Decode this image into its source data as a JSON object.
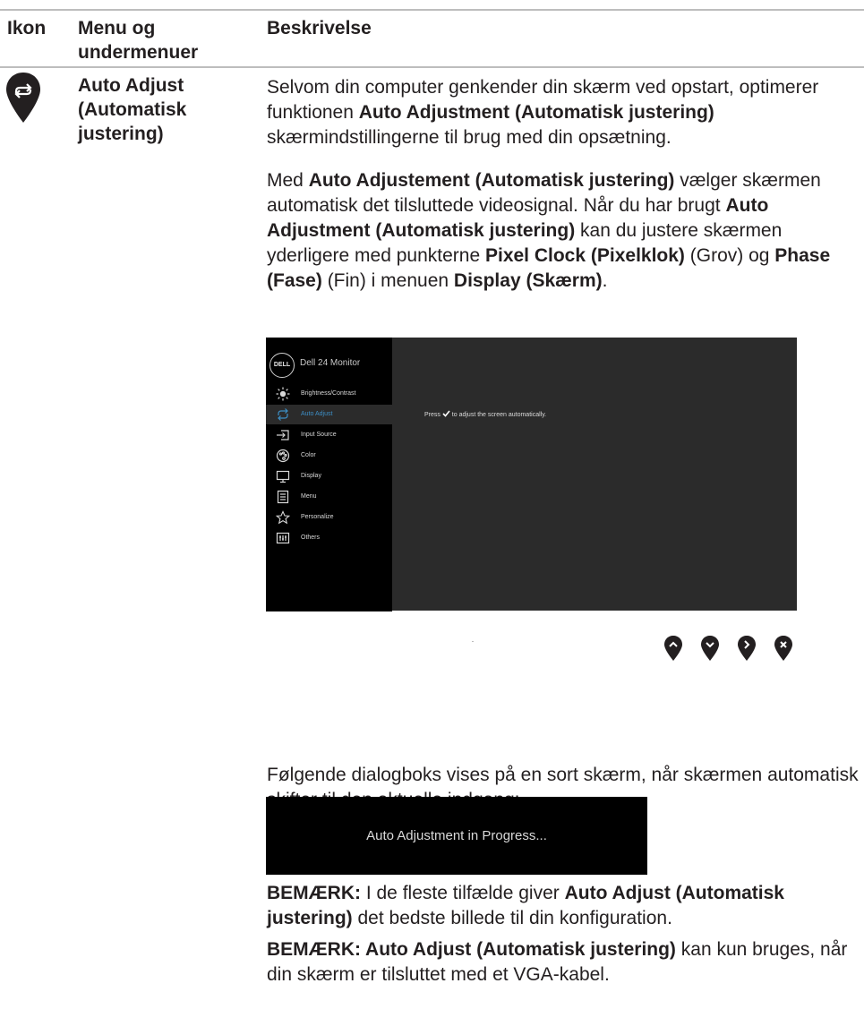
{
  "header": {
    "icon_col": "Ikon",
    "menu_col": "Menu og undermenuer",
    "desc_col": "Beskrivelse"
  },
  "row": {
    "icon": "auto-adjust-icon",
    "menu_title": "Auto Adjust (Automatisk justering)",
    "p1": {
      "a": "Selvom din computer genkender din skærm ved opstart, optimerer funktionen ",
      "b": "Auto Adjustment (Automatisk justering)",
      "c": " skærmindstillingerne til brug med din opsætning."
    },
    "p2": {
      "a": "Med ",
      "b": "Auto Adjustement (Automatisk justering)",
      "c": " vælger skærmen automatisk det tilsluttede videosignal. Når du har brugt ",
      "d": "Auto Adjustment (Automatisk justering)",
      "e": " kan du justere skærmen yderligere med punkterne ",
      "f": "Pixel Clock (Pixelklok)",
      "g": " (Grov) og ",
      "h": "Phase (Fase)",
      "i": " (Fin) i menuen ",
      "j": "Display (Skærm)",
      "k": "."
    },
    "p3": "Følgende dialogboks vises på en sort skærm, når skærmen automatisk skifter til den aktuelle indgang:",
    "p4": {
      "a": "BEMÆRK:",
      "b": " I de fleste tilfælde giver ",
      "c": "Auto Adjust (Automatisk justering)",
      "d": " det bedste billede til din konfiguration."
    },
    "p5": {
      "a": "BEMÆRK: Auto Adjust (Automatisk justering)",
      "b": " kan kun bruges, når din skærm er tilsluttet med et VGA-kabel."
    }
  },
  "osd": {
    "logo": "DELL",
    "title": "Dell 24 Monitor",
    "items": [
      {
        "label": "Brightness/Contrast",
        "icon": "brightness-icon"
      },
      {
        "label": "Auto Adjust",
        "icon": "auto-adjust-icon"
      },
      {
        "label": "Input Source",
        "icon": "input-source-icon"
      },
      {
        "label": "Color",
        "icon": "color-icon"
      },
      {
        "label": "Display",
        "icon": "display-icon"
      },
      {
        "label": "Menu",
        "icon": "menu-icon"
      },
      {
        "label": "Personalize",
        "icon": "star-icon"
      },
      {
        "label": "Others",
        "icon": "others-icon"
      }
    ],
    "active_index": 1,
    "message_a": "Press",
    "message_b": " to adjust the screen automatically.",
    "accent": "#3d8fc6"
  },
  "nav_buttons": [
    "up-icon",
    "down-icon",
    "right-icon",
    "close-icon"
  ],
  "auto_dialog": "Auto Adjustment in Progress..."
}
